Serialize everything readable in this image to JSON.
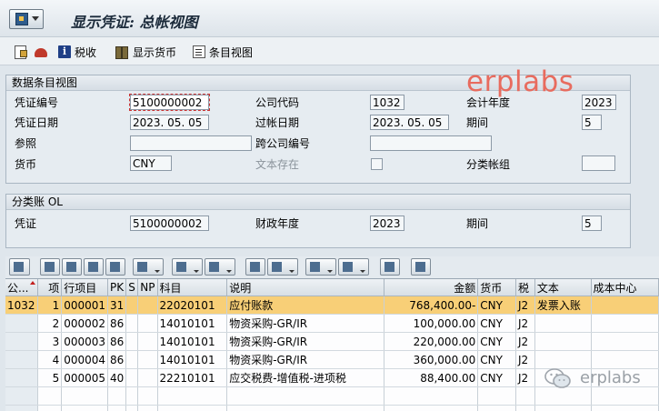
{
  "window": {
    "title": "显示凭证: 总帐视图"
  },
  "toolbar": {
    "tax_label": "税收",
    "display_currency_label": "显示货币",
    "entry_view_label": "条目视图"
  },
  "watermark": {
    "text": "erplabs",
    "footer_text": "erplabs"
  },
  "entry_view": {
    "title": "数据条目视图",
    "doc_no_label": "凭证编号",
    "doc_no": "5100000002",
    "company_code_label": "公司代码",
    "company_code": "1032",
    "fiscal_year_label": "会计年度",
    "fiscal_year": "2023",
    "doc_date_label": "凭证日期",
    "doc_date": "2023. 05. 05",
    "posting_date_label": "过帐日期",
    "posting_date": "2023. 05. 05",
    "period_label": "期间",
    "period": "5",
    "reference_label": "参照",
    "reference": "",
    "cross_cc_label": "跨公司编号",
    "cross_cc": "",
    "currency_label": "货币",
    "currency": "CNY",
    "text_exists_label": "文本存在",
    "ledger_group_label": "分类帐组",
    "ledger_group": ""
  },
  "ledger": {
    "title": "分类账 OL",
    "doc_label": "凭证",
    "doc": "5100000002",
    "fy_label": "财政年度",
    "fy": "2023",
    "period_label": "期间",
    "period": "5"
  },
  "grid": {
    "columns": [
      "公...",
      "项",
      "行项目",
      "PK",
      "S",
      "NP",
      "科目",
      "说明",
      "金额",
      "货币",
      "税",
      "文本",
      "成本中心"
    ],
    "rows": [
      [
        "1032",
        "1",
        "000001",
        "31",
        "",
        "",
        "22020101",
        "应付账款",
        "768,400.00-",
        "CNY",
        "J2",
        "发票入账",
        ""
      ],
      [
        "",
        "2",
        "000002",
        "86",
        "",
        "",
        "14010101",
        "物资采购-GR/IR",
        "100,000.00",
        "CNY",
        "J2",
        "",
        ""
      ],
      [
        "",
        "3",
        "000003",
        "86",
        "",
        "",
        "14010101",
        "物资采购-GR/IR",
        "220,000.00",
        "CNY",
        "J2",
        "",
        ""
      ],
      [
        "",
        "4",
        "000004",
        "86",
        "",
        "",
        "14010101",
        "物资采购-GR/IR",
        "360,000.00",
        "CNY",
        "J2",
        "",
        ""
      ],
      [
        "",
        "5",
        "000005",
        "40",
        "",
        "",
        "22210101",
        "应交税费-增值税-进项税",
        "88,400.00",
        "CNY",
        "J2",
        "",
        ""
      ]
    ]
  }
}
